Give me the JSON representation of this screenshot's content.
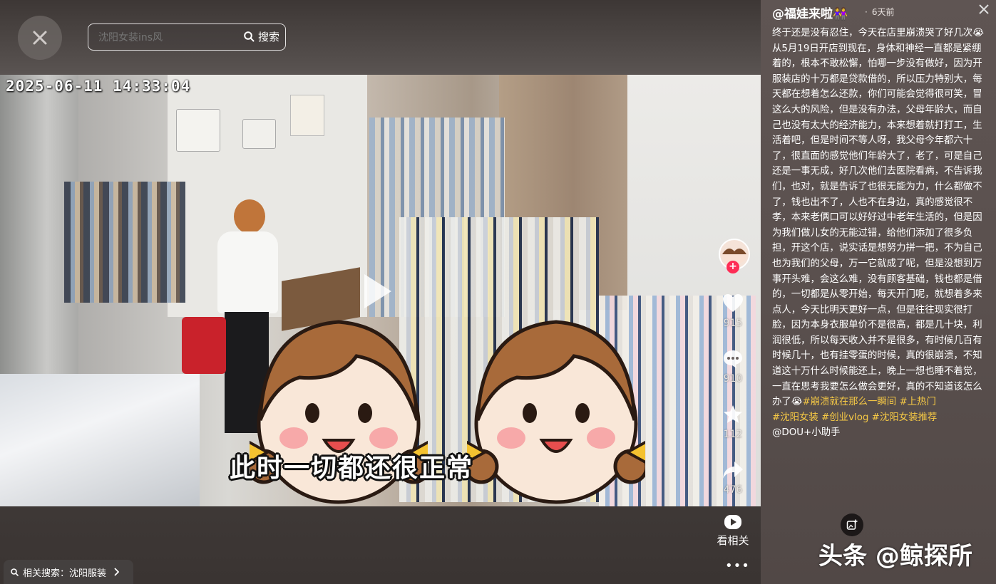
{
  "search": {
    "placeholder": "沈阳女装ins风",
    "button_label": "搜索"
  },
  "video": {
    "timestamp": "2025-06-11  14:33:04",
    "caption": "此时一切都还很正常"
  },
  "actions": {
    "likes": "915",
    "comments": "910",
    "favorites": "112",
    "shares": "476",
    "related_video_label": "看相关",
    "more": "•••"
  },
  "related_search": {
    "label": "相关搜索：沈阳服装"
  },
  "post": {
    "author": "@福娃来啦👭",
    "time_sep": "·",
    "time": "6天前",
    "body_parts": [
      "终于还是没有忍住，今天在店里崩溃哭了好几次😭从5月19日开店到现在，身体和神经一直都是紧绷着的，根本不敢松懈，怕哪一步没有做好，因为开服装店的十万都是贷款借的，所以压力特别大，每天都在想着怎么还款，你们可能会觉得很可笑，冒这么大的风险，但是没有办法，父母年龄大，而自己也没有太大的经济能力，本来想着就打打工，生活着吧，但是时间不等人呀，我父母今年都六十了，很直面的感觉他们年龄大了，老了，可是自己还是一事无成，好几次他们去医院看病，不告诉我们，也对，就是告诉了也很无能为力，什么都做不了，钱也出不了，人也不在身边，真的感觉很不孝，本来老俩口可以好好过中老年生活的，但是因为我们做儿女的无能过错，给他们添加了很多负担，开这个店，说实话是想努力拼一把，不为自己也为我们的父母，万一它就成了呢，但是没想到万事开头难，会这么难，没有顾客基础，钱也都是借的，一切都是从零开始，每天开门呢，就想着多来点人，今天比明天更好一点，但是往往现实很打脸，因为本身衣服单价不是很高，都是几十块，利润很低，所以每天收入并不是很多，有时候几百有时候几十，也有挂零蛋的时候，真的很崩溃，不知道这十万什么时候能还上，晚上一想也睡不着觉，一直在思考我要怎么做会更好，真的不知道该怎么办了😭"
    ],
    "tags": [
      "#崩溃就在那么一瞬间",
      "#上热门",
      "#沈阳女装",
      "#创业vlog",
      "#沈阳女装推荐"
    ],
    "helper": "@DOU+小助手"
  },
  "watermark": "头条 @鲸探所",
  "colors": {
    "tag": "#f6c945",
    "follow": "#fe2c55"
  }
}
